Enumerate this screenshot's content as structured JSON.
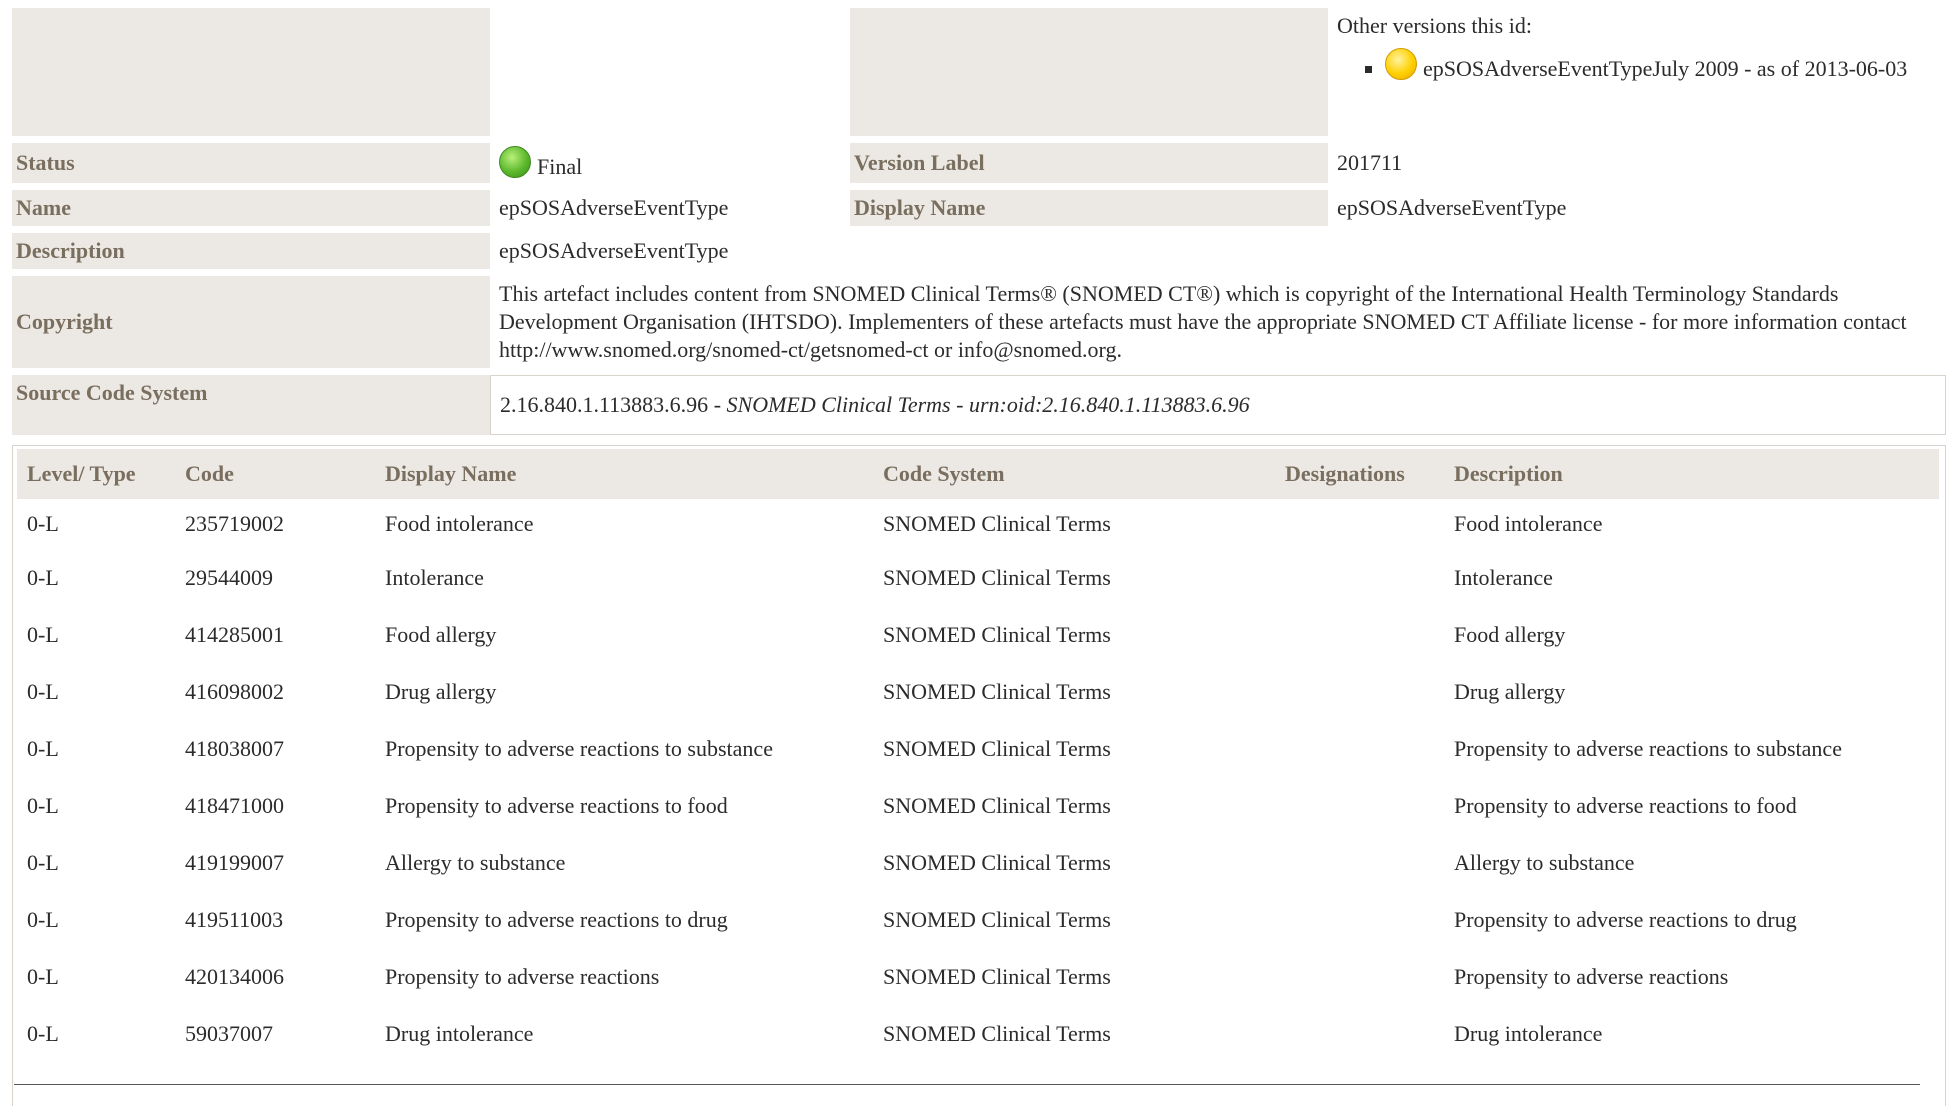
{
  "other_versions": {
    "label": "Other versions this id:",
    "items": [
      {
        "text": "epSOSAdverseEventTypeJuly 2009 - as of 2013-06-03",
        "status_color": "#ffd000"
      }
    ]
  },
  "status": {
    "label": "Status",
    "value": "Final",
    "color": "#5cb82d"
  },
  "version_label": {
    "label": "Version Label",
    "value": "201711"
  },
  "name": {
    "label": "Name",
    "value": "epSOSAdverseEventType"
  },
  "display_name": {
    "label": "Display Name",
    "value": "epSOSAdverseEventType"
  },
  "description": {
    "label": "Description",
    "value": "epSOSAdverseEventType"
  },
  "copyright": {
    "label": "Copyright",
    "value": "This artefact includes content from SNOMED Clinical Terms® (SNOMED CT®) which is copyright of the International Health Terminology Standards Development Organisation (IHTSDO). Implementers of these artefacts must have the appropriate SNOMED CT Affiliate license - for more information contact http://www.snomed.org/snomed-ct/getsnomed-ct or info@snomed.org."
  },
  "source_code_system": {
    "label": "Source Code System",
    "oid": "2.16.840.1.113883.6.96",
    "sep1": " - ",
    "name": "SNOMED Clinical Terms",
    "sep2": " - ",
    "urn": "urn:oid:2.16.840.1.113883.6.96"
  },
  "codes_table": {
    "headers": [
      "Level/ Type",
      "Code",
      "Display Name",
      "Code System",
      "Designations",
      "Description"
    ],
    "rows": [
      {
        "level": "0-L",
        "code": "235719002",
        "display": "Food intolerance",
        "system": "SNOMED Clinical Terms",
        "designations": "",
        "description": "Food intolerance"
      },
      {
        "level": "0-L",
        "code": "29544009",
        "display": "Intolerance",
        "system": "SNOMED Clinical Terms",
        "designations": "",
        "description": "Intolerance"
      },
      {
        "level": "0-L",
        "code": "414285001",
        "display": "Food allergy",
        "system": "SNOMED Clinical Terms",
        "designations": "",
        "description": "Food allergy"
      },
      {
        "level": "0-L",
        "code": "416098002",
        "display": "Drug allergy",
        "system": "SNOMED Clinical Terms",
        "designations": "",
        "description": "Drug allergy"
      },
      {
        "level": "0-L",
        "code": "418038007",
        "display": "Propensity to adverse reactions to substance",
        "system": "SNOMED Clinical Terms",
        "designations": "",
        "description": "Propensity to adverse reactions to substance"
      },
      {
        "level": "0-L",
        "code": "418471000",
        "display": "Propensity to adverse reactions to food",
        "system": "SNOMED Clinical Terms",
        "designations": "",
        "description": "Propensity to adverse reactions to food"
      },
      {
        "level": "0-L",
        "code": "419199007",
        "display": "Allergy to substance",
        "system": "SNOMED Clinical Terms",
        "designations": "",
        "description": "Allergy to substance"
      },
      {
        "level": "0-L",
        "code": "419511003",
        "display": "Propensity to adverse reactions to drug",
        "system": "SNOMED Clinical Terms",
        "designations": "",
        "description": "Propensity to adverse reactions to drug"
      },
      {
        "level": "0-L",
        "code": "420134006",
        "display": "Propensity to adverse reactions",
        "system": "SNOMED Clinical Terms",
        "designations": "",
        "description": "Propensity to adverse reactions"
      },
      {
        "level": "0-L",
        "code": "59037007",
        "display": "Drug intolerance",
        "system": "SNOMED Clinical Terms",
        "designations": "",
        "description": "Drug intolerance"
      }
    ]
  }
}
